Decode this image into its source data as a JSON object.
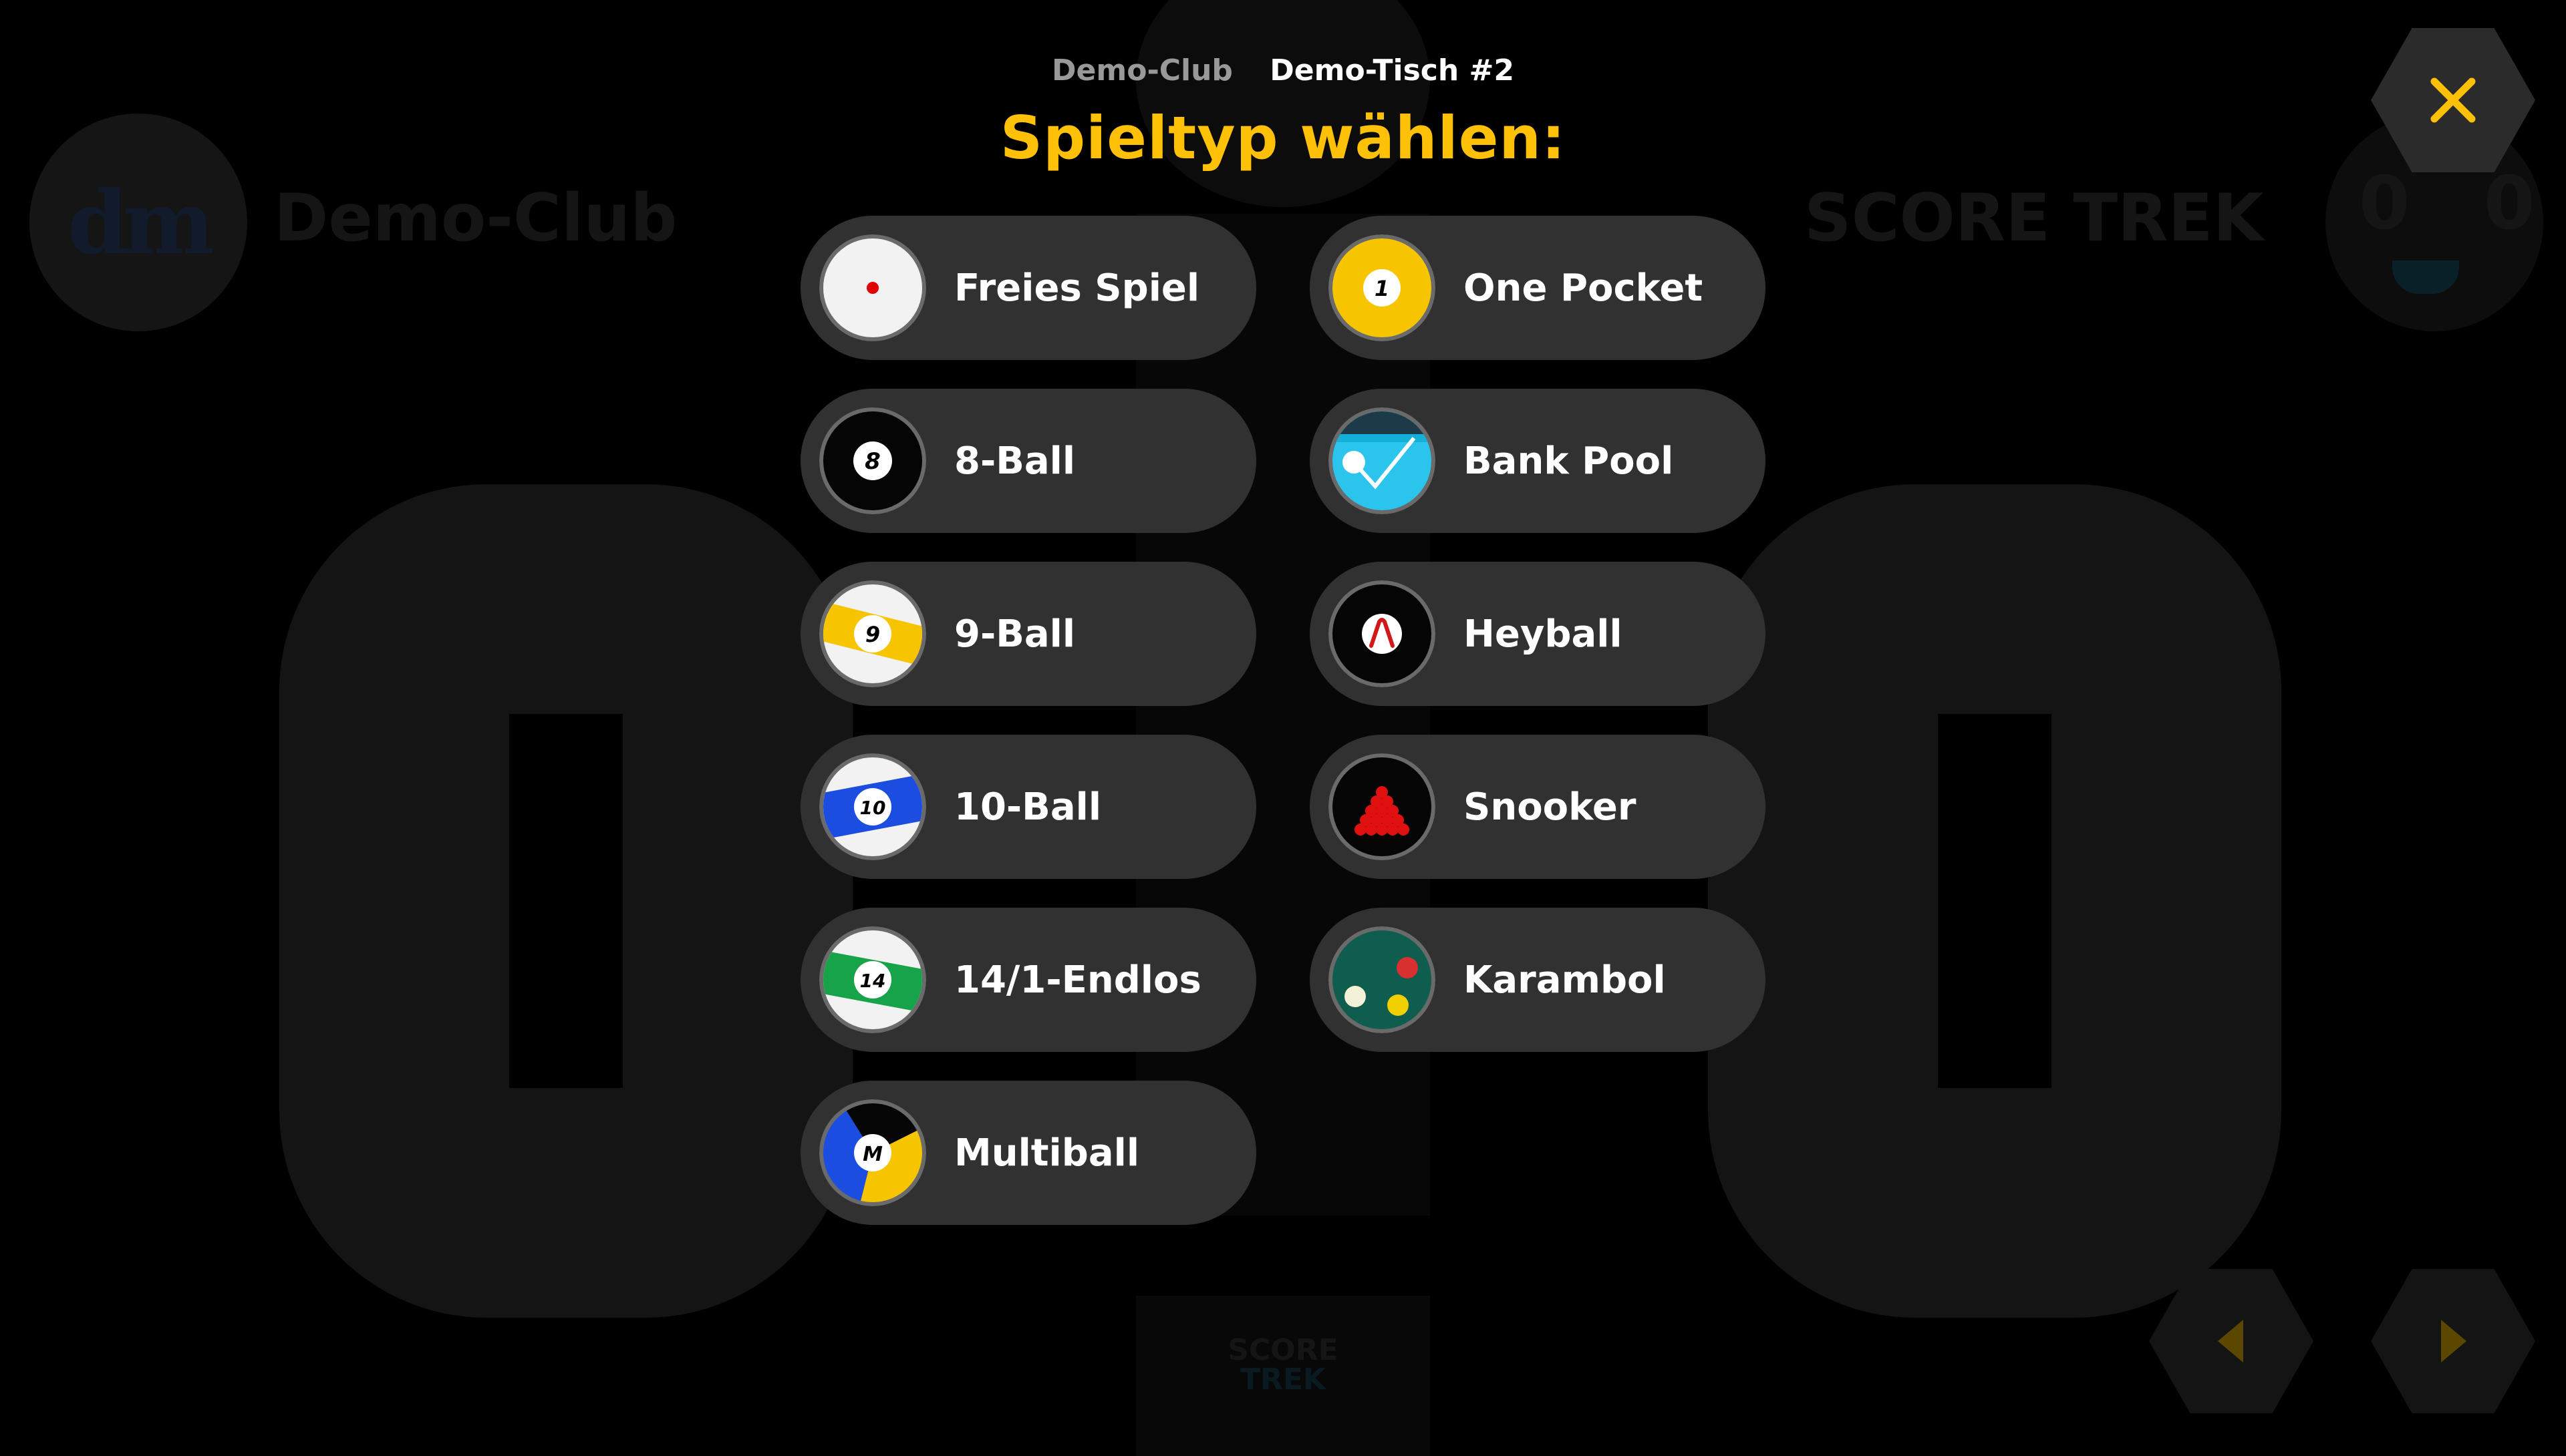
{
  "header": {
    "club": "Demo-Club",
    "table": "Demo-Tisch #2"
  },
  "title": "Spieltyp wählen:",
  "background": {
    "club_name": "Demo-Club",
    "logo_text": "dm",
    "brand": "SCORE TREK",
    "score_left": "0",
    "score_right": "0",
    "mini_score": "0 0",
    "bottom_brand_1": "SCORE",
    "bottom_brand_2": "TREK"
  },
  "games": {
    "left": [
      {
        "label": "Freies Spiel",
        "icon": "free-game-cue-ball-icon",
        "ball_number": ""
      },
      {
        "label": "8-Ball",
        "icon": "eight-ball-icon",
        "ball_number": "8"
      },
      {
        "label": "9-Ball",
        "icon": "nine-ball-icon",
        "ball_number": "9"
      },
      {
        "label": "10-Ball",
        "icon": "ten-ball-icon",
        "ball_number": "10"
      },
      {
        "label": "14/1-Endlos",
        "icon": "fourteen-ball-icon",
        "ball_number": "14"
      },
      {
        "label": "Multiball",
        "icon": "multiball-icon",
        "ball_number": "M"
      }
    ],
    "right": [
      {
        "label": "One Pocket",
        "icon": "one-ball-icon",
        "ball_number": "1"
      },
      {
        "label": "Bank Pool",
        "icon": "bank-pool-icon",
        "ball_number": ""
      },
      {
        "label": "Heyball",
        "icon": "heyball-icon",
        "ball_number": ""
      },
      {
        "label": "Snooker",
        "icon": "snooker-triangle-icon",
        "ball_number": ""
      },
      {
        "label": "Karambol",
        "icon": "carom-balls-icon",
        "ball_number": ""
      }
    ]
  },
  "colors": {
    "accent": "#ffc107",
    "button_bg": "#313131",
    "ball_yellow": "#f7c400",
    "ball_blue": "#1a4de0",
    "ball_green": "#17a34a",
    "bank_cyan": "#2bc4ec",
    "carom_green": "#0f5d4f"
  }
}
